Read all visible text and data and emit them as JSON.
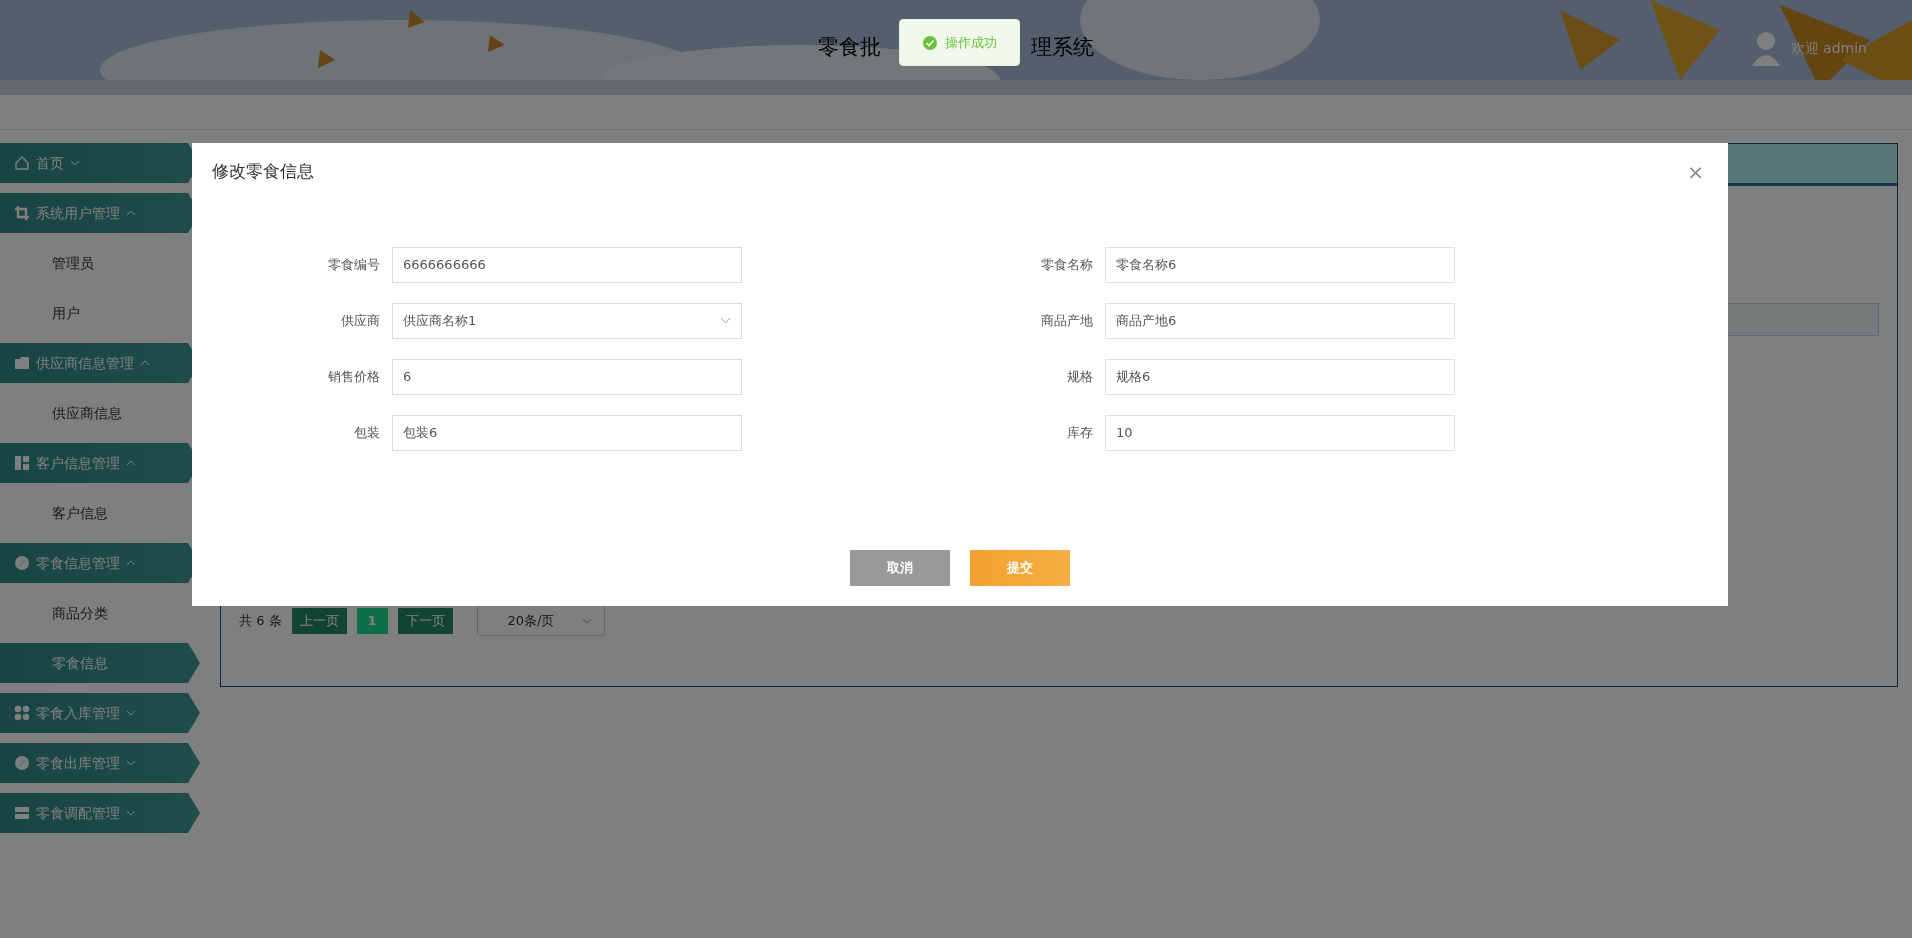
{
  "header": {
    "title_before": "零食批",
    "title_after": "理系统",
    "welcome": "欢迎 admin"
  },
  "toast": {
    "message": "操作成功"
  },
  "sidebar": {
    "items": [
      {
        "kind": "group",
        "label": "首页",
        "expanded": false
      },
      {
        "kind": "group",
        "label": "系统用户管理",
        "expanded": true,
        "children": [
          {
            "label": "管理员",
            "selected": false
          },
          {
            "label": "用户",
            "selected": false
          }
        ]
      },
      {
        "kind": "group",
        "label": "供应商信息管理",
        "expanded": true,
        "children": [
          {
            "label": "供应商信息",
            "selected": false
          }
        ]
      },
      {
        "kind": "group",
        "label": "客户信息管理",
        "expanded": true,
        "children": [
          {
            "label": "客户信息",
            "selected": false
          }
        ]
      },
      {
        "kind": "group",
        "label": "零食信息管理",
        "expanded": true,
        "children": [
          {
            "label": "商品分类",
            "selected": false
          },
          {
            "label": "零食信息",
            "selected": true
          }
        ]
      },
      {
        "kind": "group",
        "label": "零食入库管理",
        "expanded": false
      },
      {
        "kind": "group",
        "label": "零食出库管理",
        "expanded": false
      },
      {
        "kind": "group",
        "label": "零食调配管理",
        "expanded": false
      }
    ]
  },
  "pagination": {
    "total": "共 6 条",
    "prev": "上一页",
    "pages": [
      {
        "label": "1",
        "selected": true
      }
    ],
    "next": "下一页",
    "page_size": "20条/页"
  },
  "modal": {
    "title": "修改零食信息",
    "close": "×",
    "fields": [
      {
        "label": "零食编号",
        "value": "6666666666",
        "kind": "text"
      },
      {
        "label": "零食名称",
        "value": "零食名称6",
        "kind": "text"
      },
      {
        "label": "供应商",
        "value": "供应商名称1",
        "kind": "select"
      },
      {
        "label": "商品产地",
        "value": "商品产地6",
        "kind": "text"
      },
      {
        "label": "销售价格",
        "value": "6",
        "kind": "text"
      },
      {
        "label": "规格",
        "value": "规格6",
        "kind": "text"
      },
      {
        "label": "包装",
        "value": "包装6",
        "kind": "text"
      },
      {
        "label": "库存",
        "value": "10",
        "kind": "text"
      }
    ],
    "buttons": [
      {
        "label": "取消",
        "kind": "cancel"
      },
      {
        "label": "提交",
        "kind": "submit"
      }
    ]
  }
}
